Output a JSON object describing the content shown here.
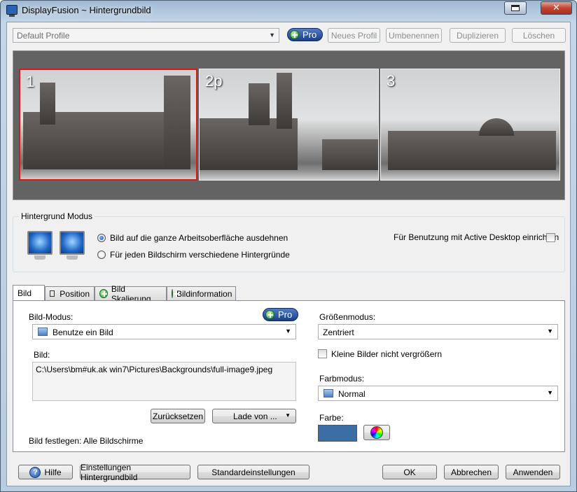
{
  "window": {
    "title": "DisplayFusion ~ Hintergrundbild"
  },
  "titlebar": {
    "close_glyph": "✕"
  },
  "profile": {
    "selected": "Default Profile",
    "pro_label": "Pro",
    "buttons": {
      "new": "Neues Profil",
      "rename": "Umbenennen",
      "duplicate": "Duplizieren",
      "delete": "Löschen"
    }
  },
  "monitors": [
    {
      "label": "1"
    },
    {
      "label": "2p"
    },
    {
      "label": "3"
    }
  ],
  "background_mode": {
    "title": "Hintergrund Modus",
    "option_stretch": "Bild auf die ganze Arbeitsoberfläche ausdehnen",
    "option_per_screen": "Für jeden Bildschirm verschiedene Hintergründe",
    "selected": "stretch",
    "active_desktop_label": "Für Benutzung mit Active Desktop einrichten",
    "active_desktop_checked": false
  },
  "tabs": [
    {
      "label": "Bild"
    },
    {
      "label": "Position"
    },
    {
      "label": "Bild Skalierung"
    },
    {
      "label": "Bildinformation"
    }
  ],
  "bild": {
    "mode_label": "Bild-Modus:",
    "mode_value": "Benutze ein Bild",
    "pro_label": "Pro",
    "image_label": "Bild:",
    "image_path": "C:\\Users\\bm#uk.ak win7\\Pictures\\Backgrounds\\full-image9.jpeg",
    "reset_button": "Zurücksetzen",
    "load_button": "Lade von ...",
    "apply_to": "Bild festlegen: Alle Bildschirme",
    "size_mode_label": "Größenmodus:",
    "size_mode_value": "Zentriert",
    "no_enlarge_label": "Kleine Bilder nicht vergrößern",
    "no_enlarge_checked": false,
    "color_mode_label": "Farbmodus:",
    "color_mode_value": "Normal",
    "color_label": "Farbe:",
    "color_value": "#3a6ea5"
  },
  "footer": {
    "help": "Hilfe",
    "wallpaper_settings": "Einstellungen Hintergrundbild",
    "defaults": "Standardeinstellungen",
    "ok": "OK",
    "cancel": "Abbrechen",
    "apply": "Anwenden"
  }
}
